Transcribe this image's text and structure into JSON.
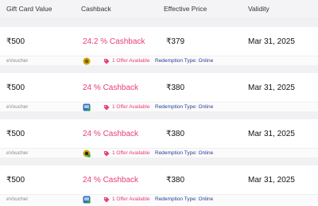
{
  "header": {
    "gift_card_value": "Gift Card Value",
    "cashback": "Cashback",
    "effective_price": "Effective Price",
    "validity": "Validity"
  },
  "colors": {
    "cashback_pink": "#e83e7a",
    "redemption_blue": "#2a3f9a"
  },
  "cards": [
    {
      "amount": "₹500",
      "cashback": "24.2 % Cashback",
      "price": "₹379",
      "validity": "Mar 31, 2025",
      "type": "eVoucher",
      "brand_icon": "yellow-brand-icon",
      "offers": "1 Offer Available",
      "redemption": "Redemption Type: Online"
    },
    {
      "amount": "₹500",
      "cashback": "24 % Cashback",
      "price": "₹380",
      "validity": "Mar 31, 2025",
      "type": "eVoucher",
      "brand_icon": "blue-brand-icon",
      "offers": "1 Offer Available",
      "redemption": "Redemption Type: Online"
    },
    {
      "amount": "₹500",
      "cashback": "24 % Cashback",
      "price": "₹380",
      "validity": "Mar 31, 2025",
      "type": "eVoucher",
      "brand_icon": "yellow-brand-icon",
      "offers": "1 Offer Available",
      "redemption": "Redemption Type: Online"
    },
    {
      "amount": "₹500",
      "cashback": "24 % Cashback",
      "price": "₹380",
      "validity": "Mar 31, 2025",
      "type": "eVoucher",
      "brand_icon": "blue-brand-icon",
      "offers": "1 Offer Available",
      "redemption": "Redemption Type: Online"
    }
  ]
}
